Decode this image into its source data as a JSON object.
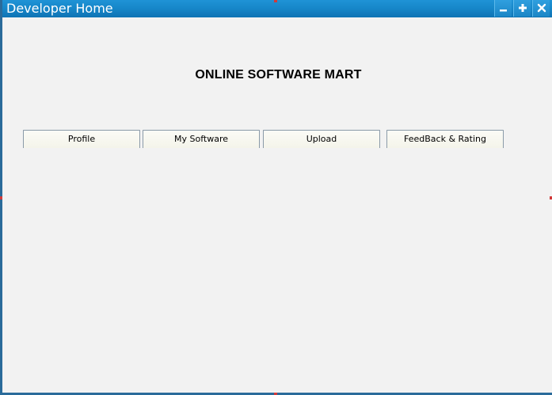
{
  "window": {
    "title": "Developer Home"
  },
  "titlebar_buttons": {
    "minimize_icon": "minimize-icon",
    "maximize_icon": "maximize-icon",
    "close_icon": "close-icon"
  },
  "main": {
    "heading": "ONLINE SOFTWARE MART",
    "tabs": [
      {
        "label": "Profile"
      },
      {
        "label": "My Software"
      },
      {
        "label": "Upload"
      },
      {
        "label": "FeedBack & Rating"
      }
    ]
  },
  "colors": {
    "titlebar": "#1686c8",
    "border": "#2a6b9a",
    "background": "#f2f2f2",
    "tab_background": "#f4f4ea"
  }
}
